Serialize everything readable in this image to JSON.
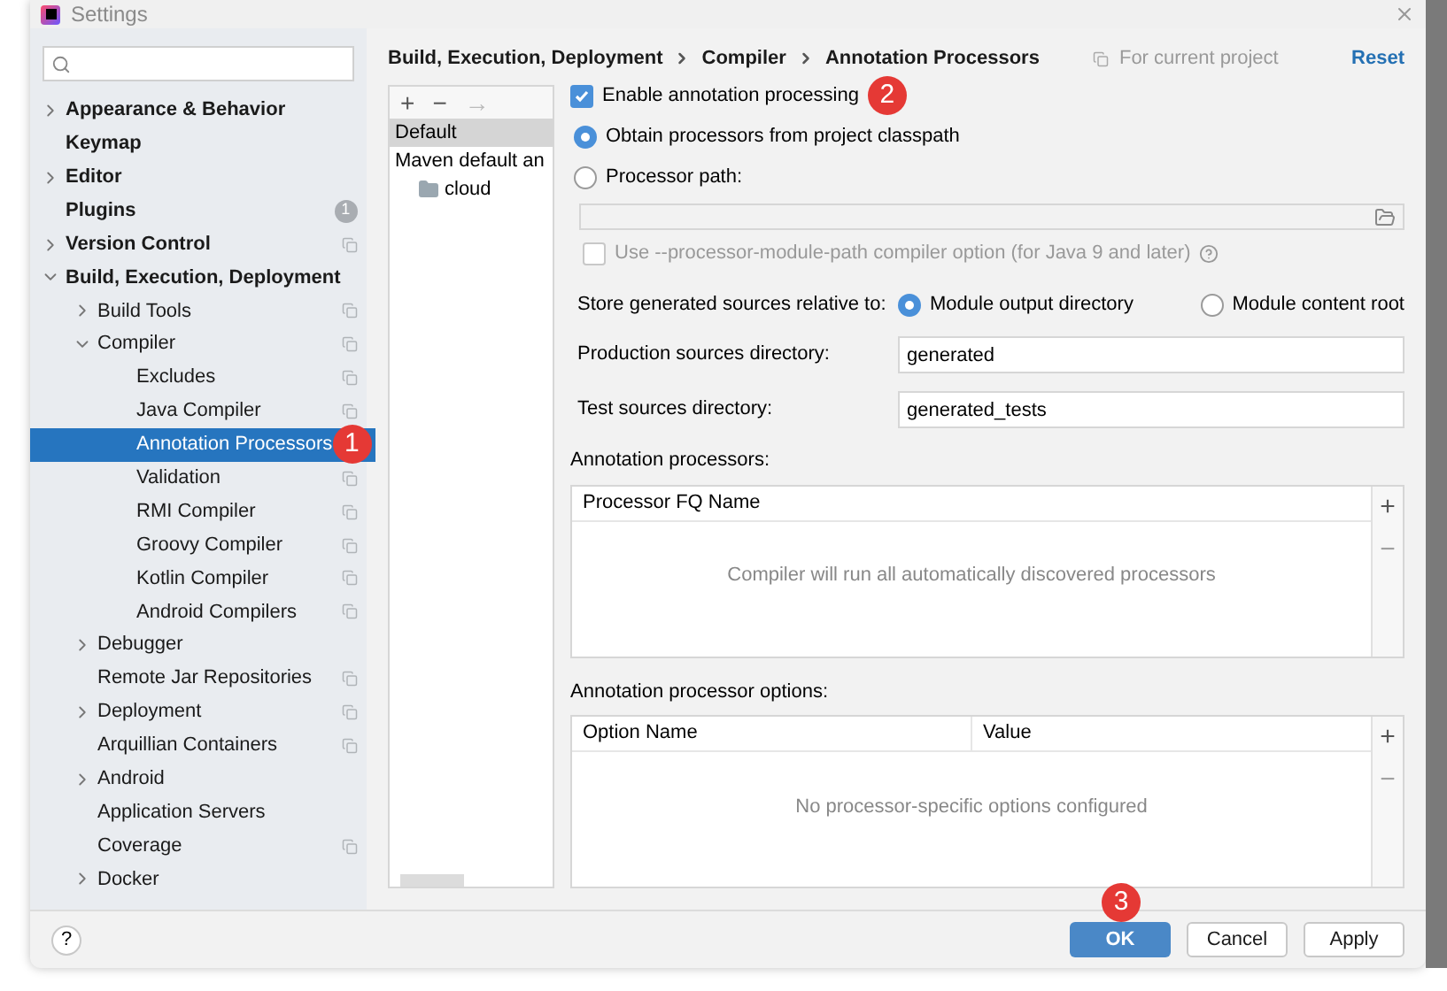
{
  "window": {
    "title": "Settings"
  },
  "sidebar": {
    "items": [
      {
        "label": "Appearance & Behavior",
        "expanded": false
      },
      {
        "label": "Keymap"
      },
      {
        "label": "Editor",
        "expanded": false
      },
      {
        "label": "Plugins",
        "count": "1"
      },
      {
        "label": "Version Control",
        "expanded": false,
        "project_scope": true
      },
      {
        "label": "Build, Execution, Deployment",
        "expanded": true,
        "children": [
          {
            "label": "Build Tools",
            "expanded": false,
            "project_scope": true
          },
          {
            "label": "Compiler",
            "expanded": true,
            "project_scope": true,
            "children": [
              {
                "label": "Excludes",
                "project_scope": true,
                "selected": false
              },
              {
                "label": "Java Compiler",
                "project_scope": true,
                "selected": false
              },
              {
                "label": "Annotation Processors",
                "project_scope": false,
                "selected": true,
                "callout": "1"
              },
              {
                "label": "Validation",
                "project_scope": true,
                "selected": false
              },
              {
                "label": "RMI Compiler",
                "project_scope": true,
                "selected": false
              },
              {
                "label": "Groovy Compiler",
                "project_scope": true,
                "selected": false
              },
              {
                "label": "Kotlin Compiler",
                "project_scope": true,
                "selected": false
              },
              {
                "label": "Android Compilers",
                "project_scope": true,
                "selected": false
              }
            ]
          },
          {
            "label": "Debugger",
            "expanded": false
          },
          {
            "label": "Remote Jar Repositories",
            "project_scope": true
          },
          {
            "label": "Deployment",
            "expanded": false,
            "project_scope": true
          },
          {
            "label": "Arquillian Containers",
            "project_scope": true
          },
          {
            "label": "Android",
            "expanded": false
          },
          {
            "label": "Application Servers"
          },
          {
            "label": "Coverage",
            "project_scope": true
          },
          {
            "label": "Docker",
            "expanded": false
          }
        ]
      }
    ]
  },
  "breadcrumb": [
    "Build, Execution, Deployment",
    "Compiler",
    "Annotation Processors"
  ],
  "scope_note": "For current project",
  "reset_link": "Reset",
  "profiles": {
    "toolbar": [
      {
        "symbol": "+",
        "disabled": false
      },
      {
        "symbol": "−",
        "disabled": false
      },
      {
        "symbol": "→",
        "disabled": true
      }
    ],
    "items": [
      {
        "label": "Default",
        "selected": true
      },
      {
        "label": "Maven default an",
        "selected": false,
        "children": [
          {
            "label": "cloud",
            "selected": false
          }
        ]
      }
    ]
  },
  "enable_processing": {
    "label": "Enable annotation processing",
    "checked": true,
    "callout": "2"
  },
  "source_options": [
    {
      "label": "Obtain processors from project classpath",
      "selected": true
    },
    {
      "label": "Processor path:",
      "selected": false
    }
  ],
  "processor_path": {
    "disabled": true
  },
  "module_path_option": {
    "label": "Use --processor-module-path compiler option (for Java 9 and later)",
    "checked": false,
    "disabled": true
  },
  "store_relative": {
    "label": "Store generated sources relative to:",
    "options": [
      {
        "label": "Module output directory",
        "selected": true
      },
      {
        "label": "Module content root",
        "selected": false
      }
    ]
  },
  "directories": [
    {
      "label": "Production sources directory:",
      "value": "generated"
    },
    {
      "label": "Test sources directory:",
      "value": "generated_tests"
    }
  ],
  "tables": [
    {
      "title": "Annotation processors:",
      "columns": [
        "Processor FQ Name"
      ],
      "empty_text": "Compiler will run all automatically discovered processors"
    },
    {
      "title": "Annotation processor options:",
      "columns": [
        "Option Name",
        "Value"
      ],
      "empty_text": "No processor-specific options configured"
    }
  ],
  "table_toolbar": [
    {
      "symbol": "+",
      "disabled": false
    },
    {
      "symbol": "−",
      "disabled": true
    }
  ],
  "footer": {
    "help": "?",
    "buttons": [
      {
        "label": "OK",
        "primary": true,
        "callout": "3"
      },
      {
        "label": "Cancel",
        "primary": false
      },
      {
        "label": "Apply",
        "primary": false
      }
    ]
  }
}
